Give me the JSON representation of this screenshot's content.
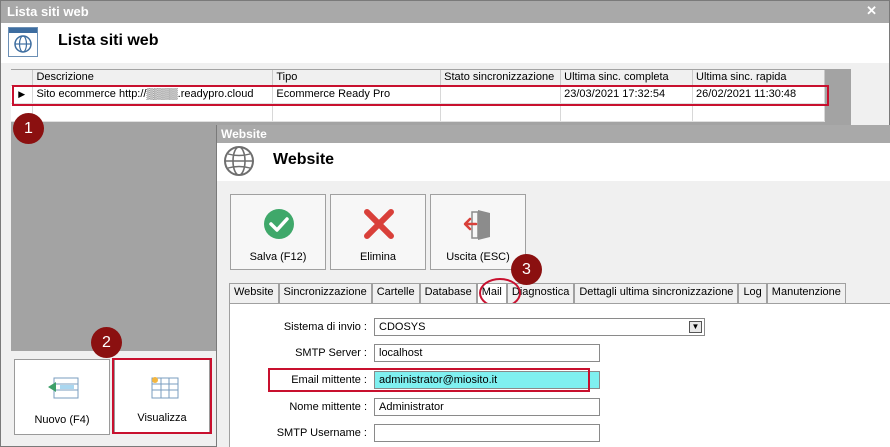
{
  "outer_window": {
    "title_bar": "Lista siti web",
    "close": "✕",
    "header_title": "Lista siti web"
  },
  "grid": {
    "columns": [
      "Descrizione",
      "Tipo",
      "Stato sincronizzazione",
      "Ultima sinc. completa",
      "Ultima sinc. rapida"
    ],
    "rows": [
      {
        "indicator": "▶",
        "descrizione": "Sito ecommerce http://▒▒▒▒.readypro.cloud",
        "tipo": "Ecommerce Ready Pro",
        "stato": "",
        "completa": "23/03/2021 17:32:54",
        "rapida": "26/02/2021 11:30:48"
      }
    ]
  },
  "bottom_buttons": {
    "nuovo": "Nuovo (F4)",
    "visualizza": "Visualizza"
  },
  "badges": [
    "1",
    "2",
    "3"
  ],
  "website_window": {
    "title_bar": "Website",
    "header_title": "Website",
    "toolbar": {
      "save": "Salva (F12)",
      "delete": "Elimina",
      "exit": "Uscita (ESC)"
    },
    "tabs": [
      "Website",
      "Sincronizzazione",
      "Cartelle",
      "Database",
      "Mail",
      "Diagnostica",
      "Dettagli ultima sincronizzazione",
      "Log",
      "Manutenzione"
    ],
    "active_tab": "Mail",
    "form": {
      "sistema_label": "Sistema di invio :",
      "sistema_value": "CDOSYS",
      "smtp_server_label": "SMTP Server :",
      "smtp_server_value": "localhost",
      "email_label": "Email mittente :",
      "email_value": "administrator@miosito.it",
      "nome_label": "Nome mittente :",
      "nome_value": "Administrator",
      "smtp_user_label": "SMTP Username :",
      "smtp_user_value": ""
    }
  },
  "colors": {
    "highlight_red": "#c8102e",
    "badge": "#8b1010",
    "email_input_bg": "#7ff0f0",
    "save_green": "#3fa86a",
    "delete_red": "#d9403a"
  }
}
